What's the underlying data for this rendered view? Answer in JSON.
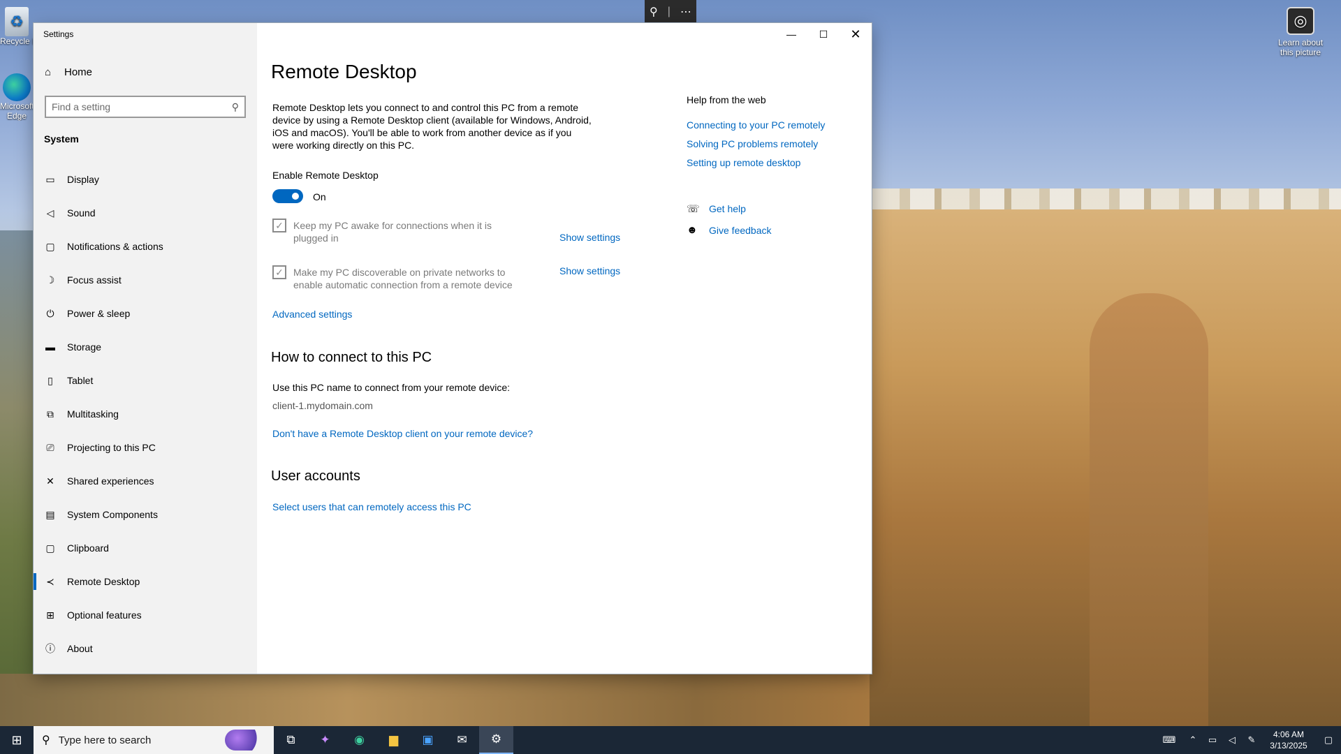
{
  "desktop": {
    "recycle_label": "Recycle Bin",
    "edge_label": "Microsoft Edge",
    "learn_label": "Learn about this picture"
  },
  "window": {
    "title": "Settings"
  },
  "sidebar": {
    "home_label": "Home",
    "search_placeholder": "Find a setting",
    "section_title": "System",
    "items": [
      {
        "label": "Display",
        "icon": "monitor-icon"
      },
      {
        "label": "Sound",
        "icon": "speaker-icon"
      },
      {
        "label": "Notifications & actions",
        "icon": "notification-icon"
      },
      {
        "label": "Focus assist",
        "icon": "moon-icon"
      },
      {
        "label": "Power & sleep",
        "icon": "power-icon"
      },
      {
        "label": "Storage",
        "icon": "storage-icon"
      },
      {
        "label": "Tablet",
        "icon": "tablet-icon"
      },
      {
        "label": "Multitasking",
        "icon": "multitasking-icon"
      },
      {
        "label": "Projecting to this PC",
        "icon": "projecting-icon"
      },
      {
        "label": "Shared experiences",
        "icon": "shared-icon"
      },
      {
        "label": "System Components",
        "icon": "components-icon"
      },
      {
        "label": "Clipboard",
        "icon": "clipboard-icon"
      },
      {
        "label": "Remote Desktop",
        "icon": "remote-desktop-icon",
        "active": true
      },
      {
        "label": "Optional features",
        "icon": "features-icon"
      },
      {
        "label": "About",
        "icon": "info-icon"
      }
    ]
  },
  "content": {
    "title": "Remote Desktop",
    "description": "Remote Desktop lets you connect to and control this PC from a remote device by using a Remote Desktop client (available for Windows, Android, iOS and macOS). You'll be able to work from another device as if you were working directly on this PC.",
    "enable_label": "Enable Remote Desktop",
    "toggle_state": "On",
    "checkbox1_text": "Keep my PC awake for connections when it is plugged in",
    "checkbox2_text": "Make my PC discoverable on private networks to enable automatic connection from a remote device",
    "show_settings_label": "Show settings",
    "advanced_settings_label": "Advanced settings",
    "connect_heading": "How to connect to this PC",
    "connect_text": "Use this PC name to connect from your remote device:",
    "pc_name": "client-1.mydomain.com",
    "no_client_link": "Don't have a Remote Desktop client on your remote device?",
    "user_accounts_heading": "User accounts",
    "select_users_link": "Select users that can remotely access this PC"
  },
  "help": {
    "title": "Help from the web",
    "links": [
      "Connecting to your PC remotely",
      "Solving PC problems remotely",
      "Setting up remote desktop"
    ],
    "get_help": "Get help",
    "give_feedback": "Give feedback"
  },
  "taskbar": {
    "search_placeholder": "Type here to search",
    "time": "4:06 AM",
    "date": "3/13/2025"
  },
  "colors": {
    "accent": "#0067c0",
    "sidebar_bg": "#f2f2f2",
    "taskbar_bg": "#1b2736"
  }
}
